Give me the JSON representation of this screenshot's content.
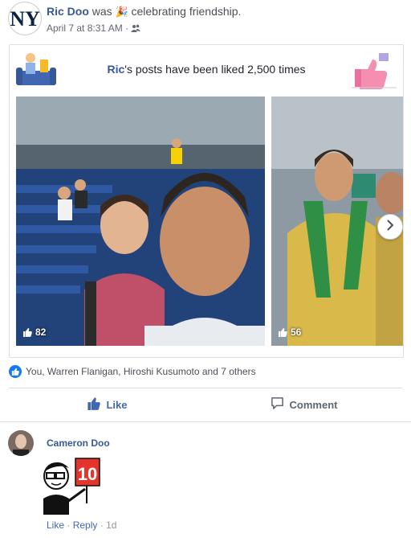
{
  "post": {
    "author": "Ric Doo",
    "was": "was",
    "feeling_icon": "party-popper",
    "feeling": "celebrating friendship.",
    "date": "April 7 at 8:31 AM",
    "separator": "·",
    "audience_icon": "friends-icon"
  },
  "card": {
    "name": "Ric",
    "message": "'s posts have been liked 2,500 times",
    "photos": [
      {
        "likes": "82"
      },
      {
        "likes": "56"
      }
    ]
  },
  "reactions": {
    "text": "You, Warren Flanigan, Hiroshi Kusumoto and 7 others"
  },
  "actions": {
    "like_label": "Like",
    "comment_label": "Comment"
  },
  "comment": {
    "author": "Cameron Doo",
    "sticker_sign": "10",
    "like_label": "Like",
    "reply_label": "Reply",
    "dot": "·",
    "time": "1d"
  },
  "colors": {
    "link_blue": "#365899",
    "like_blue": "#4267b2",
    "reaction_blue": "#1877f2"
  }
}
